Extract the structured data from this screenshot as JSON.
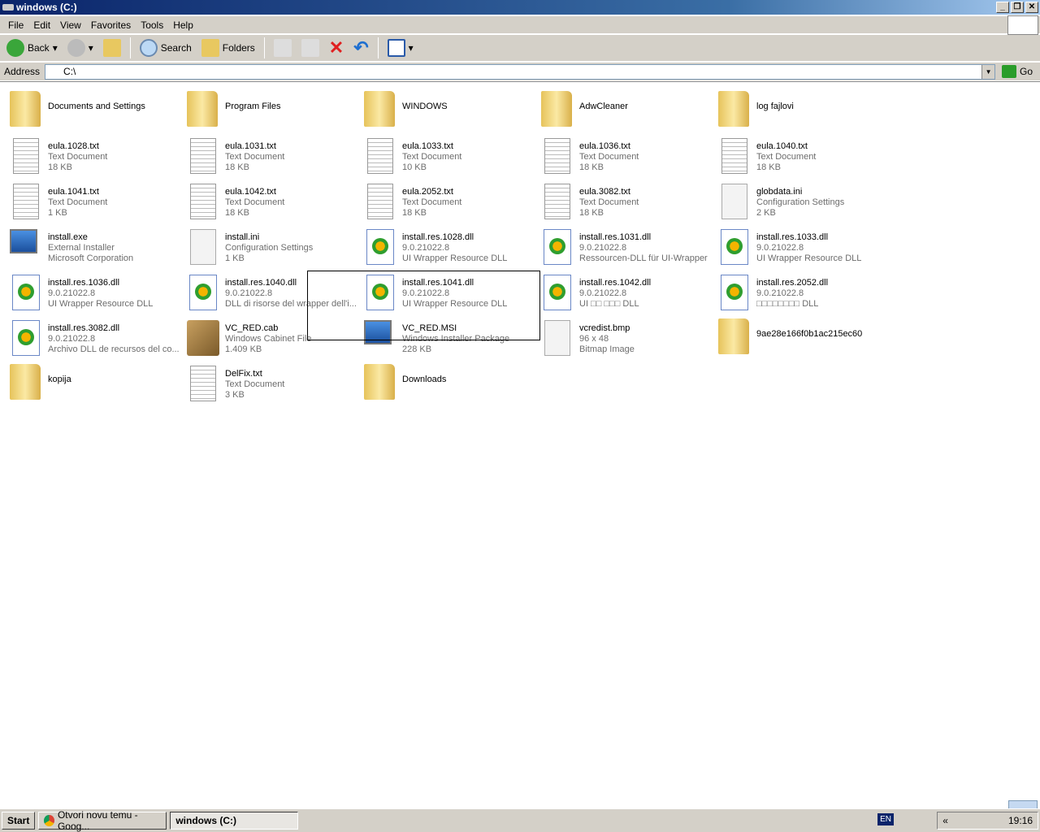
{
  "window": {
    "title": "windows (C:)"
  },
  "menu": [
    "File",
    "Edit",
    "View",
    "Favorites",
    "Tools",
    "Help"
  ],
  "toolbar": {
    "back": "Back",
    "search": "Search",
    "folders": "Folders"
  },
  "address": {
    "label": "Address",
    "value": "C:\\",
    "go": "Go"
  },
  "items": [
    {
      "type": "folder",
      "name": "Documents and Settings"
    },
    {
      "type": "folder",
      "name": "Program Files"
    },
    {
      "type": "folder",
      "name": "WINDOWS"
    },
    {
      "type": "folder",
      "name": "AdwCleaner"
    },
    {
      "type": "folder",
      "name": "log fajlovi"
    },
    {
      "type": "doc",
      "name": "eula.1028.txt",
      "l2": "Text Document",
      "l3": "18 KB"
    },
    {
      "type": "doc",
      "name": "eula.1031.txt",
      "l2": "Text Document",
      "l3": "18 KB"
    },
    {
      "type": "doc",
      "name": "eula.1033.txt",
      "l2": "Text Document",
      "l3": "10 KB"
    },
    {
      "type": "doc",
      "name": "eula.1036.txt",
      "l2": "Text Document",
      "l3": "18 KB"
    },
    {
      "type": "doc",
      "name": "eula.1040.txt",
      "l2": "Text Document",
      "l3": "18 KB"
    },
    {
      "type": "doc",
      "name": "eula.1041.txt",
      "l2": "Text Document",
      "l3": "1 KB"
    },
    {
      "type": "doc",
      "name": "eula.1042.txt",
      "l2": "Text Document",
      "l3": "18 KB"
    },
    {
      "type": "doc",
      "name": "eula.2052.txt",
      "l2": "Text Document",
      "l3": "18 KB"
    },
    {
      "type": "doc",
      "name": "eula.3082.txt",
      "l2": "Text Document",
      "l3": "18 KB"
    },
    {
      "type": "blank",
      "name": "globdata.ini",
      "l2": "Configuration Settings",
      "l3": "2 KB"
    },
    {
      "type": "exe",
      "name": "install.exe",
      "l2": "External Installer",
      "l3": "Microsoft Corporation"
    },
    {
      "type": "blank",
      "name": "install.ini",
      "l2": "Configuration Settings",
      "l3": "1 KB"
    },
    {
      "type": "dll",
      "name": "install.res.1028.dll",
      "l2": "9.0.21022.8",
      "l3": "UI Wrapper Resource DLL"
    },
    {
      "type": "dll",
      "name": "install.res.1031.dll",
      "l2": "9.0.21022.8",
      "l3": "Ressourcen-DLL für UI-Wrapper"
    },
    {
      "type": "dll",
      "name": "install.res.1033.dll",
      "l2": "9.0.21022.8",
      "l3": "UI Wrapper Resource DLL"
    },
    {
      "type": "dll",
      "name": "install.res.1036.dll",
      "l2": "9.0.21022.8",
      "l3": "UI Wrapper Resource DLL"
    },
    {
      "type": "dll",
      "name": "install.res.1040.dll",
      "l2": "9.0.21022.8",
      "l3": "DLL di risorse del wrapper dell'i..."
    },
    {
      "type": "dll",
      "name": "install.res.1041.dll",
      "l2": "9.0.21022.8",
      "l3": "UI Wrapper Resource DLL"
    },
    {
      "type": "dll",
      "name": "install.res.1042.dll",
      "l2": "9.0.21022.8",
      "l3": "UI □□ □□□ DLL"
    },
    {
      "type": "dll",
      "name": "install.res.2052.dll",
      "l2": "9.0.21022.8",
      "l3": "□□□□□□□□ DLL"
    },
    {
      "type": "dll",
      "name": "install.res.3082.dll",
      "l2": "9.0.21022.8",
      "l3": "Archivo DLL de recursos del co..."
    },
    {
      "type": "cab",
      "name": "VC_RED.cab",
      "l2": "Windows Cabinet File",
      "l3": "1.409 KB"
    },
    {
      "type": "exe",
      "name": "VC_RED.MSI",
      "l2": "Windows Installer Package",
      "l3": "228 KB"
    },
    {
      "type": "blank",
      "name": "vcredist.bmp",
      "l2": "96 x 48",
      "l3": "Bitmap Image"
    },
    {
      "type": "folder",
      "name": "9ae28e166f0b1ac215ec60"
    },
    {
      "type": "folder",
      "name": "kopija"
    },
    {
      "type": "doc",
      "name": "DelFix.txt",
      "l2": "Text Document",
      "l3": "3 KB"
    },
    {
      "type": "folder",
      "name": "Downloads"
    }
  ],
  "taskbar": {
    "start": "Start",
    "tasks": [
      "Otvori novu temu - Goog...",
      "windows (C:)"
    ],
    "lang": "EN",
    "clock": "19:16"
  }
}
